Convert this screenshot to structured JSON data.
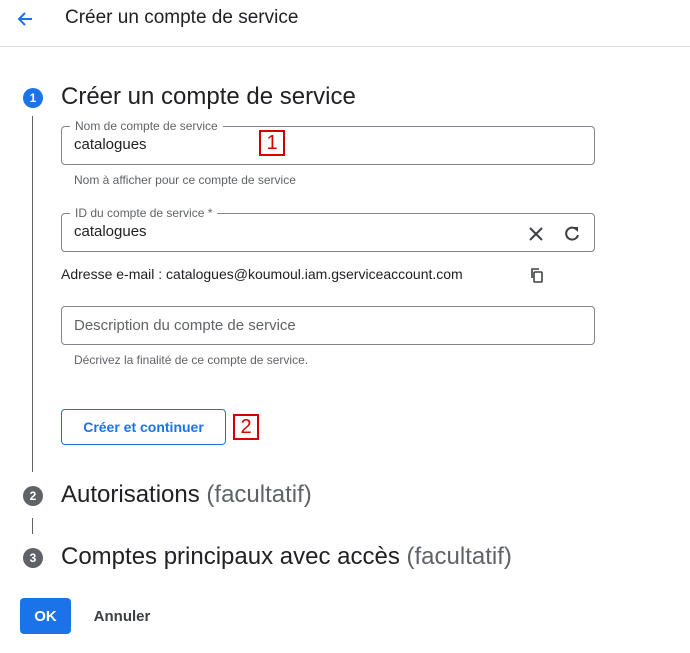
{
  "header": {
    "title": "Créer un compte de service"
  },
  "steps": [
    {
      "number": "1",
      "title": "Créer un compte de service",
      "optional": ""
    },
    {
      "number": "2",
      "title": "Autorisations",
      "optional": "(facultatif)"
    },
    {
      "number": "3",
      "title": "Comptes principaux avec accès",
      "optional": "(facultatif)"
    }
  ],
  "form": {
    "name_field": {
      "label": "Nom de compte de service",
      "value": "catalogues",
      "hint": "Nom à afficher pour ce compte de service"
    },
    "id_field": {
      "label": "ID du compte de service *",
      "value": "catalogues"
    },
    "email_line": "Adresse e-mail : catalogues@koumoul.iam.gserviceaccount.com",
    "description_field": {
      "placeholder": "Description du compte de service",
      "hint": "Décrivez la finalité de ce compte de service."
    },
    "continue_label": "Créer et continuer"
  },
  "annotations": [
    "1",
    "2"
  ],
  "footer": {
    "ok_label": "OK",
    "cancel_label": "Annuler"
  },
  "colors": {
    "accent": "#1a73e8",
    "annotation": "#d50000",
    "inactive_step": "#5f6368"
  },
  "icons": {
    "back": "arrow-back-icon",
    "clear": "close-icon",
    "regenerate": "refresh-icon",
    "copy": "copy-icon"
  }
}
